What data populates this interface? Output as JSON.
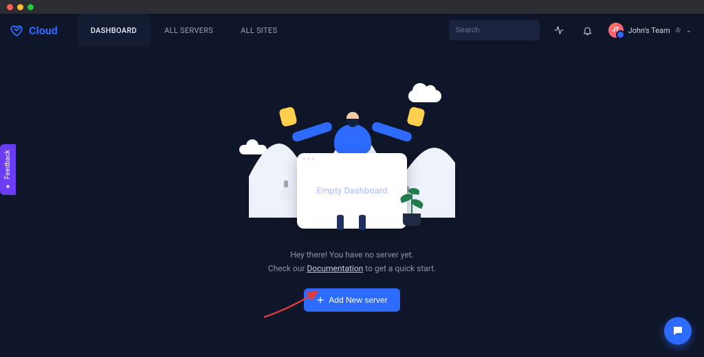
{
  "brand": {
    "name": "Cloud"
  },
  "nav": {
    "tabs": [
      {
        "label": "DASHBOARD",
        "active": true
      },
      {
        "label": "ALL SERVERS",
        "active": false
      },
      {
        "label": "ALL SITES",
        "active": false
      }
    ]
  },
  "search": {
    "placeholder": "Search"
  },
  "team": {
    "initials": "JT",
    "name": "John's Team"
  },
  "empty": {
    "card_title": "Empty Dashboard",
    "line1": "Hey there! You have no server yet.",
    "line2_before": "Check our ",
    "line2_link": "Documentation",
    "line2_after": " to get a quick start."
  },
  "cta": {
    "label": "Add New server"
  },
  "feedback": {
    "label": "Feedback"
  }
}
